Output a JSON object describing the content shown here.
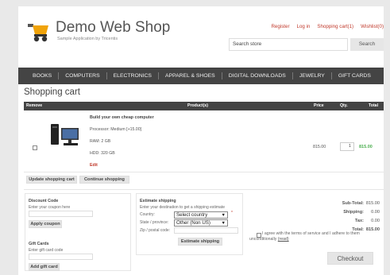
{
  "header": {
    "logo_title": "Demo Web Shop",
    "logo_subtitle": "Sample Application by Tricentis",
    "links": [
      "Register",
      "Log in",
      "Shopping cart(1)",
      "Wishlist(0)"
    ],
    "search_placeholder": "Search store",
    "search_button": "Search"
  },
  "menu": {
    "items": [
      "BOOKS",
      "COMPUTERS",
      "ELECTRONICS",
      "APPAREL & SHOES",
      "DIGITAL DOWNLOADS",
      "JEWELRY",
      "GIFT CARDS"
    ]
  },
  "page": {
    "title": "Shopping cart"
  },
  "cart": {
    "columns": {
      "remove": "Remove",
      "product": "Product(s)",
      "price": "Price",
      "qty": "Qty.",
      "total": "Total"
    },
    "item": {
      "name": "Build your own cheap computer",
      "attributes": [
        "Processor: Medium [+15.00]",
        "RAM: 2 GB",
        "HDD: 320 GB"
      ],
      "edit": "Edit",
      "price": "815.00",
      "qty": "1",
      "total": "815.00"
    },
    "buttons": {
      "update": "Update shopping cart",
      "continue": "Continue shopping"
    }
  },
  "discount": {
    "title": "Discount Code",
    "hint": "Enter your coupon here",
    "button": "Apply coupon"
  },
  "gift_cards": {
    "title": "Gift Cards",
    "hint": "Enter gift card code",
    "button": "Add gift card"
  },
  "shipping": {
    "title": "Estimate shipping",
    "hint": "Enter your destination to get a shipping estimate",
    "country_label": "Country:",
    "country_value": "Select country",
    "state_label": "State / province:",
    "state_value": "Other (Non US)",
    "zip_label": "Zip / postal code:",
    "button": "Estimate shipping",
    "required_marker": "*"
  },
  "totals": {
    "subtotal_label": "Sub-Total:",
    "subtotal_value": "815.00",
    "shipping_label": "Shipping:",
    "shipping_value": "0.00",
    "tax_label": "Tax:",
    "tax_value": "0.00",
    "total_label": "Total:",
    "total_value": "815.00"
  },
  "terms": {
    "text": "I agree with the terms of service and I adhere to them unconditionally",
    "link": "(read)"
  },
  "checkout": {
    "button": "Checkout"
  },
  "colors": {
    "accent_red": "#c0392b",
    "menu_bg": "#444444",
    "total_green": "#4caf50",
    "logo_orange": "#f0a30a"
  },
  "icons": {
    "logo": "shopping-cart-icon",
    "product": "computer-tower-monitor-image"
  }
}
